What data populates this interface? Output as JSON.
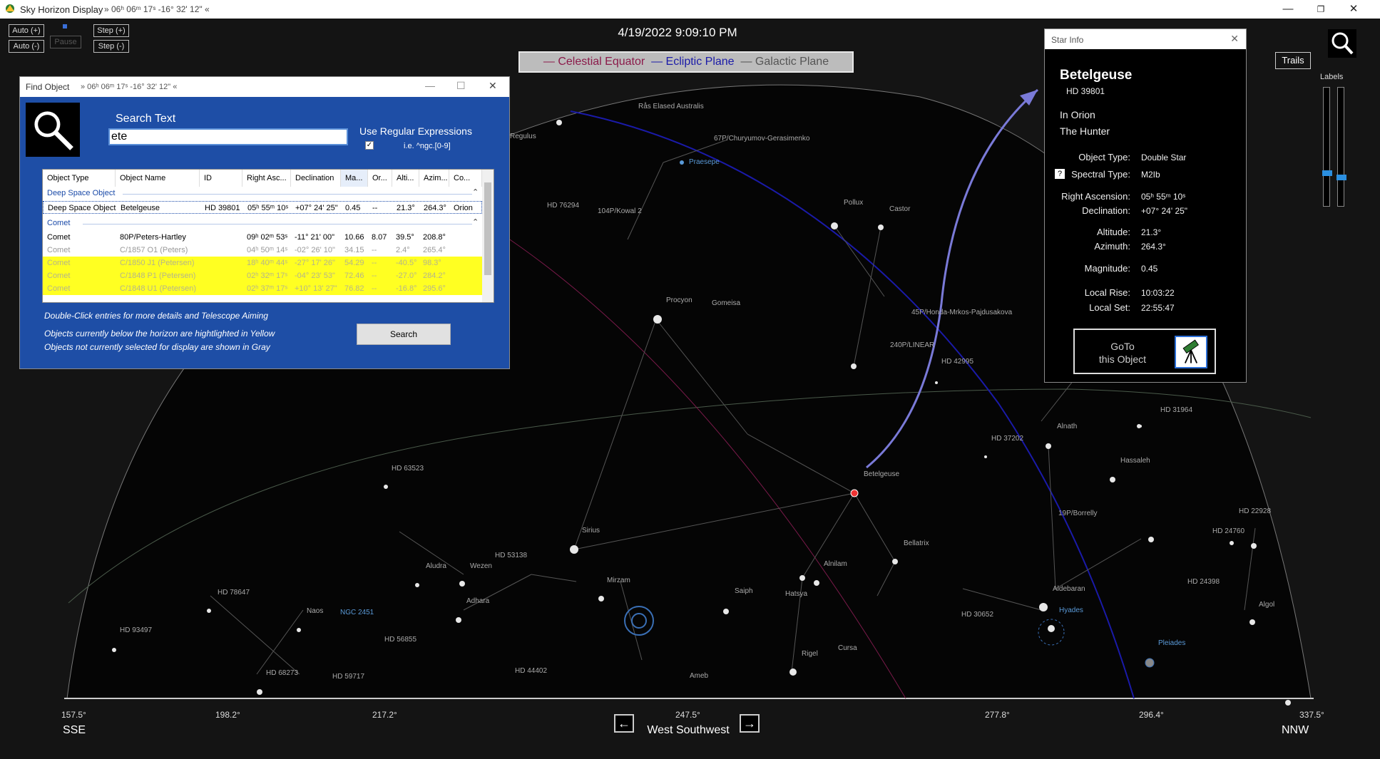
{
  "window": {
    "title": "Sky Horizon Display",
    "coords": "» 06ʰ 06ᵐ 17ˢ  -16° 32' 12\" «",
    "min": "—",
    "restore": "❐",
    "close": "✕"
  },
  "controls": {
    "auto_plus": "Auto (+)",
    "auto_minus": "Auto (-)",
    "pause": "Pause",
    "step_plus": "Step (+)",
    "step_minus": "Step (-)"
  },
  "datetime": "4/19/2022 9:09:10 PM",
  "planes": {
    "celestial": "Celestial Equator",
    "ecliptic": "Ecliptic Plane",
    "galactic": "Galactic Plane"
  },
  "trails": "Trails",
  "labels": "Labels",
  "bottom": {
    "deg_left": "157.5°",
    "deg_2": "198.2°",
    "deg_3": "217.2°",
    "deg_center": "247.5°",
    "deg_5": "277.8°",
    "deg_6": "296.4°",
    "deg_right": "337.5°",
    "dir_left": "SSE",
    "dir_center": "West Southwest",
    "dir_right": "NNW",
    "arrow_left": "←",
    "arrow_right": "→"
  },
  "sky_labels": [
    {
      "text": "Rås Elased Australis",
      "kind": "star"
    },
    {
      "text": "Regulus",
      "kind": "star"
    },
    {
      "text": "67P/Churyumov-Gerasimenko",
      "kind": "comet"
    },
    {
      "text": "Praesepe",
      "kind": "dso"
    },
    {
      "text": "HD 76294",
      "kind": "star"
    },
    {
      "text": "104P/Kowal 2",
      "kind": "comet"
    },
    {
      "text": "Pollux",
      "kind": "star"
    },
    {
      "text": "Castor",
      "kind": "star"
    },
    {
      "text": "Procyon",
      "kind": "star"
    },
    {
      "text": "Gomeisa",
      "kind": "star"
    },
    {
      "text": "45P/Honda-Mrkos-Pajdusakova",
      "kind": "comet"
    },
    {
      "text": "240P/LINEAR",
      "kind": "comet"
    },
    {
      "text": "HD 42995",
      "kind": "star"
    },
    {
      "text": "HD 31964",
      "kind": "star"
    },
    {
      "text": "Alnath",
      "kind": "star"
    },
    {
      "text": "HD 37202",
      "kind": "star"
    },
    {
      "text": "Hassaleh",
      "kind": "star"
    },
    {
      "text": "Betelgeuse",
      "kind": "star"
    },
    {
      "text": "HD 63523",
      "kind": "star"
    },
    {
      "text": "Sirius",
      "kind": "star"
    },
    {
      "text": "19P/Borrelly",
      "kind": "comet"
    },
    {
      "text": "HD 22928",
      "kind": "star"
    },
    {
      "text": "HD 24760",
      "kind": "star"
    },
    {
      "text": "Bellatrix",
      "kind": "star"
    },
    {
      "text": "HD 53138",
      "kind": "star"
    },
    {
      "text": "Aludra",
      "kind": "star"
    },
    {
      "text": "Wezen",
      "kind": "star"
    },
    {
      "text": "Alnilam",
      "kind": "star"
    },
    {
      "text": "Mirzam",
      "kind": "star"
    },
    {
      "text": "HD 24398",
      "kind": "star"
    },
    {
      "text": "HD 78647",
      "kind": "star"
    },
    {
      "text": "Saiph",
      "kind": "star"
    },
    {
      "text": "Hatsya",
      "kind": "star"
    },
    {
      "text": "Aldebaran",
      "kind": "star"
    },
    {
      "text": "Adhara",
      "kind": "star"
    },
    {
      "text": "Hyades",
      "kind": "dso"
    },
    {
      "text": "Algol",
      "kind": "star"
    },
    {
      "text": "Naos",
      "kind": "star"
    },
    {
      "text": "NGC 2451",
      "kind": "dso"
    },
    {
      "text": "HD 30652",
      "kind": "star"
    },
    {
      "text": "HD 93497",
      "kind": "star"
    },
    {
      "text": "HD 56855",
      "kind": "star"
    },
    {
      "text": "Pleiades",
      "kind": "dso"
    },
    {
      "text": "Rigel",
      "kind": "star"
    },
    {
      "text": "Cursa",
      "kind": "star"
    },
    {
      "text": "HD 68273",
      "kind": "star"
    },
    {
      "text": "HD 59717",
      "kind": "star"
    },
    {
      "text": "HD 44402",
      "kind": "star"
    },
    {
      "text": "Ameb",
      "kind": "star"
    }
  ],
  "find": {
    "title": "Find Object",
    "coords": "» 06ʰ 06ᵐ 17ˢ  -16° 32' 12\" «",
    "search_label": "Search Text",
    "search_value": "ete",
    "regex_label": "Use Regular Expressions",
    "regex_example": "i.e.   ^ngc.[0-9]",
    "regex_checked": "✓",
    "columns": [
      "Object Type",
      "Object Name",
      "ID",
      "Right Asc...",
      "Declination",
      "Ma...",
      "Or...",
      "Alti...",
      "Azim...",
      "Co..."
    ],
    "group1": "Deep Space Object",
    "group2": "Comet",
    "rows": [
      {
        "type": "Deep Space Object",
        "name": "Betelgeuse",
        "id": "HD 39801",
        "ra": "05ʰ 55ᵐ 10ˢ",
        "dec": "+07° 24' 25\"",
        "mag": "0.45",
        "orb": "--",
        "alt": "21.3°",
        "az": "264.3°",
        "con": "Orion",
        "style": "sel"
      },
      {
        "type": "Comet",
        "name": "80P/Peters-Hartley",
        "id": "",
        "ra": "09ʰ 02ᵐ 53ˢ",
        "dec": "-11° 21' 00\"",
        "mag": "10.66",
        "orb": "8.07",
        "alt": "39.5°",
        "az": "208.8°",
        "con": "",
        "style": "normal"
      },
      {
        "type": "Comet",
        "name": "C/1857 O1 (Peters)",
        "id": "",
        "ra": "04ʰ 50ᵐ 14ˢ",
        "dec": "-02° 26' 10\"",
        "mag": "34.15",
        "orb": "--",
        "alt": "2.4°",
        "az": "265.4°",
        "con": "",
        "style": "gray"
      },
      {
        "type": "Comet",
        "name": "C/1850 J1 (Petersen)",
        "id": "",
        "ra": "18ʰ 40ᵐ 44ˢ",
        "dec": "-27° 17' 26\"",
        "mag": "54.29",
        "orb": "--",
        "alt": "-40.5°",
        "az": "98.3°",
        "con": "",
        "style": "yellow"
      },
      {
        "type": "Comet",
        "name": "C/1848 P1 (Petersen)",
        "id": "",
        "ra": "02ʰ 32ᵐ 17ˢ",
        "dec": "-04° 23' 53\"",
        "mag": "72.46",
        "orb": "--",
        "alt": "-27.0°",
        "az": "284.2°",
        "con": "",
        "style": "yellow"
      },
      {
        "type": "Comet",
        "name": "C/1848 U1 (Petersen)",
        "id": "",
        "ra": "02ʰ 37ᵐ 17ˢ",
        "dec": "+10° 13' 27\"",
        "mag": "76.82",
        "orb": "--",
        "alt": "-16.8°",
        "az": "295.6°",
        "con": "",
        "style": "yellow"
      }
    ],
    "note1": "Double-Click entries for more details and Telescope Aiming",
    "note2": "Objects currently below the horizon are hightlighted in Yellow",
    "note3": "Objects not currently selected for display are shown in Gray",
    "search_button": "Search"
  },
  "star_info": {
    "title": "Star Info",
    "name": "Betelgeuse",
    "id": "HD 39801",
    "constellation": "In Orion",
    "constellation_name": "The Hunter",
    "object_type_label": "Object Type:",
    "object_type": "Double Star",
    "spectral_label": "Spectral Type:",
    "spectral": "M2Ib",
    "spectral_help": "?",
    "ra_label": "Right Ascension:",
    "ra": "05ʰ 55ᵐ 10ˢ",
    "dec_label": "Declination:",
    "dec": "+07° 24' 25\"",
    "alt_label": "Altitude:",
    "alt": "21.3°",
    "az_label": "Azimuth:",
    "az": "264.3°",
    "mag_label": "Magnitude:",
    "mag": "0.45",
    "rise_label": "Local Rise:",
    "rise": "10:03:22",
    "set_label": "Local Set:",
    "set": "22:55:47",
    "goto_line1": "GoTo",
    "goto_line2": "this Object"
  },
  "colors": {
    "celestial_equator": "#8b1a4a",
    "ecliptic": "#1a1aa8",
    "galactic": "#555555",
    "find_bg": "#1e4ea6",
    "below_horizon": "#ffff22",
    "slider_thumb": "#2b8fe0"
  }
}
